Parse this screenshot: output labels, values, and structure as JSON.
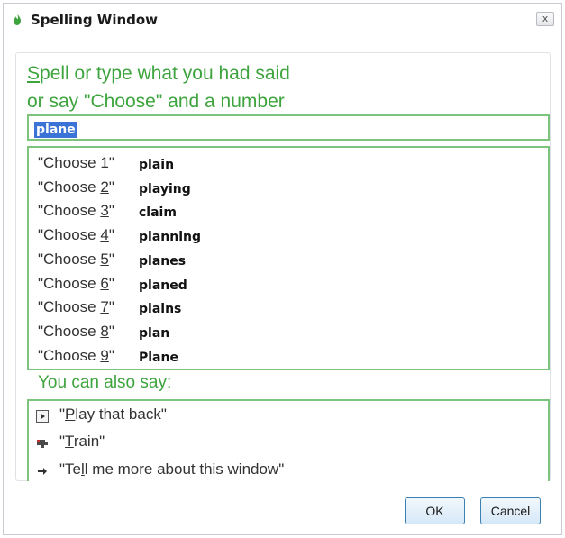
{
  "window": {
    "title": "Spelling Window",
    "close_label": "x"
  },
  "prompt": {
    "line1_underlined": "S",
    "line1_rest": "pell or type what you had said",
    "line2": "or say \"Choose\" and a number"
  },
  "spell_input": {
    "value": "plane"
  },
  "choices": [
    {
      "prefix": "\"Choose ",
      "number": "1",
      "suffix": "\"",
      "word": "plain"
    },
    {
      "prefix": "\"Choose ",
      "number": "2",
      "suffix": "\"",
      "word": "playing"
    },
    {
      "prefix": "\"Choose ",
      "number": "3",
      "suffix": "\"",
      "word": "claim"
    },
    {
      "prefix": "\"Choose ",
      "number": "4",
      "suffix": "\"",
      "word": "planning"
    },
    {
      "prefix": "\"Choose ",
      "number": "5",
      "suffix": "\"",
      "word": "planes"
    },
    {
      "prefix": "\"Choose ",
      "number": "6",
      "suffix": "\"",
      "word": "planed"
    },
    {
      "prefix": "\"Choose ",
      "number": "7",
      "suffix": "\"",
      "word": "plains"
    },
    {
      "prefix": "\"Choose ",
      "number": "8",
      "suffix": "\"",
      "word": "plan"
    },
    {
      "prefix": "\"Choose ",
      "number": "9",
      "suffix": "\"",
      "word": "Plane"
    }
  ],
  "also_say": {
    "heading": "You can also say:"
  },
  "commands": [
    {
      "icon": "play-icon",
      "pre": "\"",
      "ul": "P",
      "post": "lay that back\""
    },
    {
      "icon": "train-icon",
      "pre": "\"",
      "ul": "T",
      "post": "rain\""
    },
    {
      "icon": "arrow-right-icon",
      "pre": "\"Te",
      "ul": "l",
      "post": "l me more about this window\""
    }
  ],
  "buttons": {
    "ok": "OK",
    "cancel": "Cancel"
  },
  "colors": {
    "accent_green": "#3ea43e",
    "border_green": "#7cc47c",
    "selection_blue": "#3b73d6"
  }
}
